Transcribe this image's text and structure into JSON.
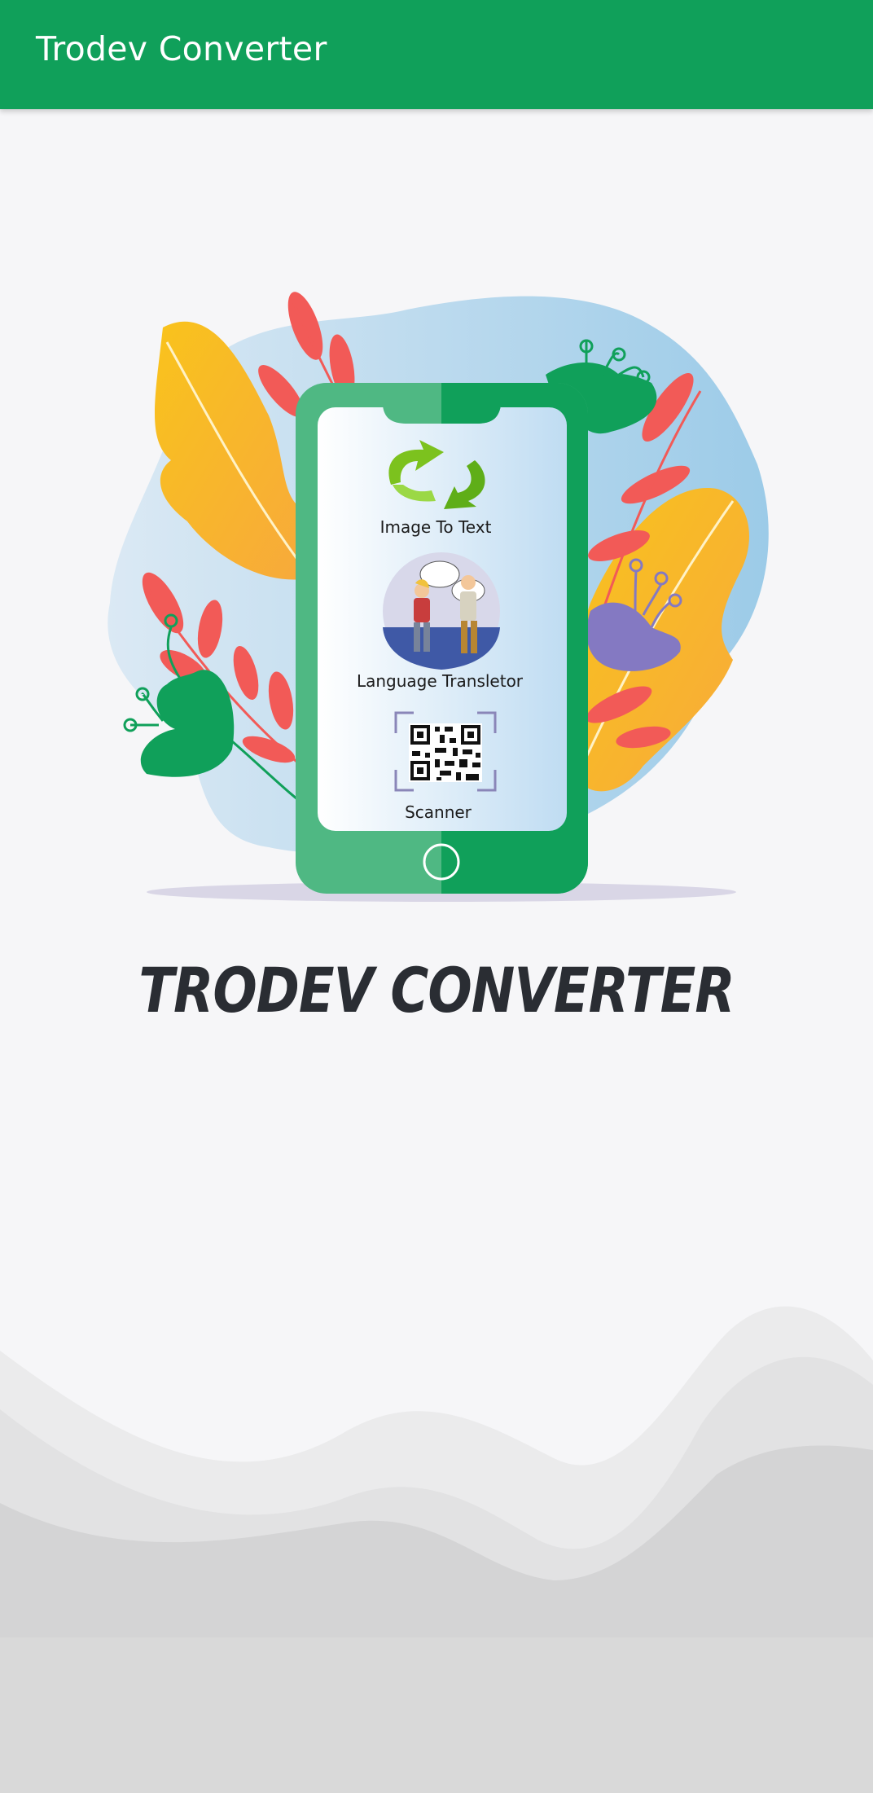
{
  "app_bar": {
    "title": "Trodev Converter"
  },
  "phone_menu": {
    "items": [
      {
        "label": "Image To Text",
        "icon": "recycle-arrows-icon"
      },
      {
        "label": "Language Transletor",
        "icon": "translator-people-icon"
      },
      {
        "label": "Scanner",
        "icon": "qr-code-icon"
      }
    ]
  },
  "brand": {
    "title": "TRODEV CONVERTER"
  },
  "colors": {
    "primary": "#10a05a",
    "phone_body": "#4fb883",
    "leaf_red": "#f25a57",
    "leaf_yellow": "#f9bc1c",
    "blob_blue": "#a9d3ec",
    "title_dark": "#2a2d33"
  }
}
